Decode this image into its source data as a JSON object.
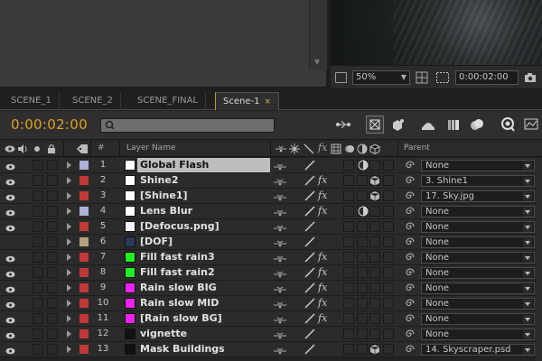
{
  "viewer": {
    "zoom": "50%",
    "timecode": "0:00:02:00"
  },
  "tabs": [
    {
      "label": "SCENE_1",
      "active": false
    },
    {
      "label": "SCENE_2",
      "active": false
    },
    {
      "label": "SCENE_FINAL",
      "active": false
    },
    {
      "label": "Scene-1",
      "active": true,
      "close": "×"
    }
  ],
  "timeline": {
    "current_time": "0:00:02:00",
    "search_placeholder": ""
  },
  "columns": {
    "hash": "#",
    "layer_name": "Layer Name",
    "parent": "Parent"
  },
  "colors": {
    "timecode": "#e0a020",
    "label_lavender": "#aeb0d8",
    "label_red": "#c03838",
    "label_tan": "#b4a080"
  },
  "layers": [
    {
      "num": "1",
      "name": "Global Flash",
      "label": "#aeb0d8",
      "swatch": "#ffffff",
      "fx": false,
      "motion_blur": true,
      "cube": false,
      "parent": "None",
      "selected": true,
      "eye": true
    },
    {
      "num": "2",
      "name": "Shine2",
      "label": "#c03838",
      "swatch": "#ffffff",
      "fx": true,
      "motion_blur": false,
      "cube": true,
      "parent": "3. Shine1",
      "selected": false,
      "eye": true
    },
    {
      "num": "3",
      "name": "[Shine1]",
      "label": "#c03838",
      "swatch": "#ffffff",
      "fx": true,
      "motion_blur": false,
      "cube": true,
      "parent": "17. Sky.jpg",
      "selected": false,
      "eye": true
    },
    {
      "num": "4",
      "name": "Lens Blur",
      "label": "#aeb0d8",
      "swatch": "#ffffff",
      "fx": true,
      "motion_blur": true,
      "cube": false,
      "parent": "None",
      "selected": false,
      "eye": true
    },
    {
      "num": "5",
      "name": "[Defocus.png]",
      "label": "#c03838",
      "swatch": "#f4f4ff",
      "fx": false,
      "motion_blur": false,
      "cube": false,
      "parent": "None",
      "selected": false,
      "eye": true
    },
    {
      "num": "6",
      "name": "[DOF]",
      "label": "#b4a080",
      "swatch": "#2a3a5a",
      "fx": false,
      "motion_blur": false,
      "cube": false,
      "parent": "None",
      "selected": false,
      "eye": false
    },
    {
      "num": "7",
      "name": "Fill fast rain3",
      "label": "#c03838",
      "swatch": "#22ee22",
      "fx": true,
      "motion_blur": false,
      "cube": false,
      "parent": "None",
      "selected": false,
      "eye": true
    },
    {
      "num": "8",
      "name": "Fill fast rain2",
      "label": "#c03838",
      "swatch": "#22ee22",
      "fx": true,
      "motion_blur": false,
      "cube": false,
      "parent": "None",
      "selected": false,
      "eye": true
    },
    {
      "num": "9",
      "name": "Rain slow BIG",
      "label": "#c03838",
      "swatch": "#ee22ee",
      "fx": true,
      "motion_blur": false,
      "cube": false,
      "parent": "None",
      "selected": false,
      "eye": true
    },
    {
      "num": "10",
      "name": "Rain slow MID",
      "label": "#c03838",
      "swatch": "#ee22ee",
      "fx": true,
      "motion_blur": false,
      "cube": false,
      "parent": "None",
      "selected": false,
      "eye": true
    },
    {
      "num": "11",
      "name": "[Rain slow BG]",
      "label": "#c03838",
      "swatch": "#ee22ee",
      "fx": true,
      "motion_blur": false,
      "cube": false,
      "parent": "None",
      "selected": false,
      "eye": true
    },
    {
      "num": "12",
      "name": "vignette",
      "label": "#c03838",
      "swatch": "#111111",
      "fx": false,
      "motion_blur": false,
      "cube": false,
      "parent": "None",
      "selected": false,
      "eye": true
    },
    {
      "num": "13",
      "name": "Mask Buildings",
      "label": "#c03838",
      "swatch": "#111111",
      "fx": false,
      "motion_blur": false,
      "cube": true,
      "parent": "14. Skyscraper.psd",
      "selected": false,
      "eye": true
    }
  ]
}
